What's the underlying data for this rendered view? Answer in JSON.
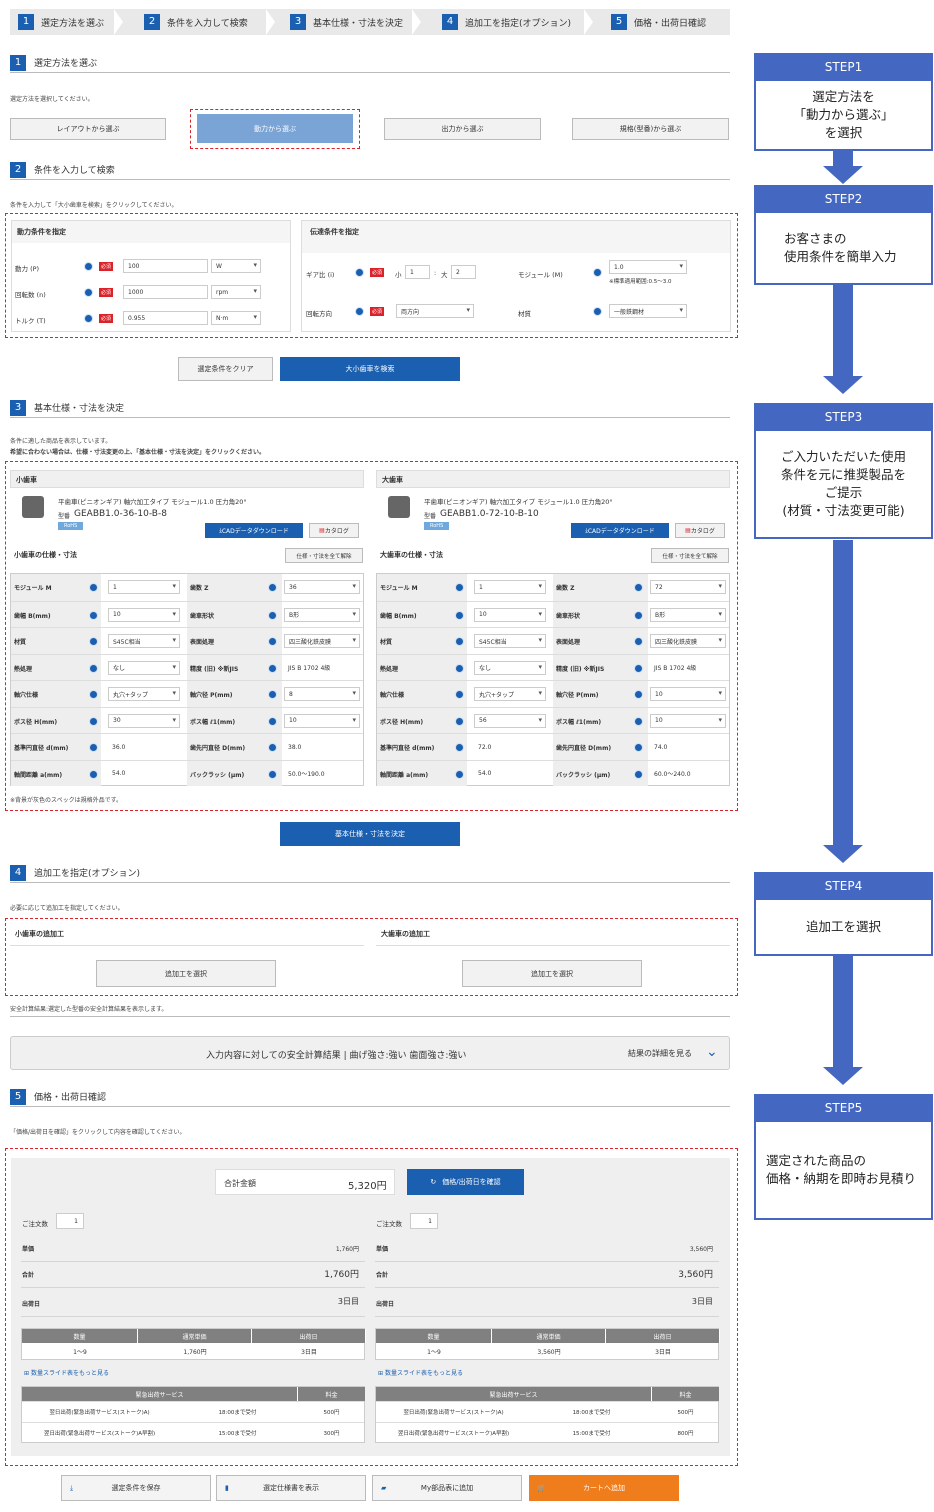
{
  "steps": [
    {
      "n": "1",
      "label": "選定方法を選ぶ"
    },
    {
      "n": "2",
      "label": "条件を入力して検索"
    },
    {
      "n": "3",
      "label": "基本仕様・寸法を決定"
    },
    {
      "n": "4",
      "label": "追加工を指定(オプション)"
    },
    {
      "n": "5",
      "label": "価格・出荷日確認"
    }
  ],
  "s1": {
    "title": "選定方法を選ぶ",
    "note": "選定方法を選択してください。",
    "buttons": [
      "レイアウトから選ぶ",
      "動力から選ぶ",
      "出力から選ぶ",
      "規格(型番)から選ぶ"
    ]
  },
  "s2": {
    "title": "条件を入力して検索",
    "note": "条件を入力して「大小歯車を検索」をクリックしてください。",
    "power_title": "動力条件を指定",
    "trans_title": "伝達条件を指定",
    "req": "必須",
    "power": [
      {
        "label": "動力 (P)",
        "value": "100",
        "unit": "W"
      },
      {
        "label": "回転数 (n)",
        "value": "1000",
        "unit": "rpm"
      },
      {
        "label": "トルク (T)",
        "value": "0.955",
        "unit": "N·m"
      }
    ],
    "ratio_label": "ギア比 (i)",
    "small": "小",
    "small_val": "1",
    "large": "大",
    "large_val": "2",
    "module_label": "モジュール (M)",
    "module_val": "1.0",
    "module_note": "※標準適用範囲:0.5〜3.0",
    "dir_label": "回転方向",
    "dir_val": "両方向",
    "mat_label": "材質",
    "mat_val": "一般鉄鋼材",
    "clear": "選定条件をクリア",
    "search": "大小歯車を検索"
  },
  "s3": {
    "title": "基本仕様・寸法を決定",
    "note1": "条件に適した商品を表示しています。",
    "note2": "希望に合わない場合は、仕様・寸法変更の上、「基本仕様・寸法を決定」をクリックください。",
    "footnote": "※背景が灰色のスペックは規格外品です。",
    "decide": "基本仕様・寸法を決定",
    "gears": [
      {
        "head": "小歯車",
        "name": "平歯車(ピニオンギア) 軸穴加工タイプ モジュール1.0 圧力角20°",
        "model_lbl": "型番",
        "model": "GEABB1.0-36-10-B-8",
        "rohs": "RoHS",
        "cad": "CADデータダウンロード",
        "catalog": "カタログ",
        "spec_title": "小歯車の仕様・寸法",
        "release": "仕様・寸法を全て解除",
        "specs": [
          [
            "モジュール M",
            "1",
            "歯数 Z",
            "36"
          ],
          [
            "歯幅 B(mm)",
            "10",
            "歯車形状",
            "B形"
          ],
          [
            "材質",
            "S45C相当",
            "表面処理",
            "四三酸化鉄皮膜"
          ],
          [
            "熱処理",
            "なし",
            "精度 (旧) ※新JIS",
            "JIS B 1702 4級"
          ],
          [
            "軸穴仕様",
            "丸穴+タップ",
            "軸穴径 P(mm)",
            "8"
          ],
          [
            "ボス径 H(mm)",
            "30",
            "ボス幅 ℓ1(mm)",
            "10"
          ],
          [
            "基準円直径 d(mm)",
            "36.0",
            "歯先円直径 D(mm)",
            "38.0"
          ],
          [
            "軸間距離 a(mm)",
            "54.0",
            "バックラッシ (μm)",
            "50.0〜190.0"
          ]
        ]
      },
      {
        "head": "大歯車",
        "name": "平歯車(ピニオンギア) 軸穴加工タイプ モジュール1.0 圧力角20°",
        "model_lbl": "型番",
        "model": "GEABB1.0-72-10-B-10",
        "rohs": "RoHS",
        "cad": "CADデータダウンロード",
        "catalog": "カタログ",
        "spec_title": "大歯車の仕様・寸法",
        "release": "仕様・寸法を全て解除",
        "specs": [
          [
            "モジュール M",
            "1",
            "歯数 Z",
            "72"
          ],
          [
            "歯幅 B(mm)",
            "10",
            "歯車形状",
            "B形"
          ],
          [
            "材質",
            "S45C相当",
            "表面処理",
            "四三酸化鉄皮膜"
          ],
          [
            "熱処理",
            "なし",
            "精度 (旧) ※新JIS",
            "JIS B 1702 4級"
          ],
          [
            "軸穴仕様",
            "丸穴+タップ",
            "軸穴径 P(mm)",
            "10"
          ],
          [
            "ボス径 H(mm)",
            "56",
            "ボス幅 ℓ1(mm)",
            "10"
          ],
          [
            "基準円直径 d(mm)",
            "72.0",
            "歯先円直径 D(mm)",
            "74.0"
          ],
          [
            "軸間距離 a(mm)",
            "54.0",
            "バックラッシ (μm)",
            "60.0〜240.0"
          ]
        ]
      }
    ]
  },
  "s4": {
    "title": "追加工を指定(オプション)",
    "note": "必要に応じて追加工を指定してください。",
    "small_head": "小歯車の追加工",
    "large_head": "大歯車の追加工",
    "btn": "追加工を選択"
  },
  "safety": {
    "note": "安全計算結果:選定した型番の安全計算結果を表示します。",
    "result": "入力内容に対しての安全計算結果 | 曲げ強さ:強い 歯面強さ:強い",
    "detail": "結果の詳細を見る"
  },
  "s5": {
    "title": "価格・出荷日確認",
    "note": "「価格/出荷日を確認」をクリックして内容を確認してください。",
    "total_lbl": "合計金額",
    "total": "5,320円",
    "confirm": "価格/出荷日を確認",
    "qty_lbl": "ご注文数",
    "unit_lbl": "単価",
    "sum_lbl": "合計",
    "ship_lbl": "出荷日",
    "th": [
      "数量",
      "通常単価",
      "出荷日"
    ],
    "more": "数量スライド表をもっと見る",
    "exp_th": [
      "緊急出荷サービス",
      "料金"
    ],
    "cols": [
      {
        "qty": "1",
        "unit": "1,760円",
        "sum": "1,760円",
        "ship": "3日目",
        "tr": [
          "1〜9",
          "1,760円",
          "3日目"
        ],
        "exp": [
          [
            "翌日出荷(緊急出荷サービス(ストーク)A)",
            "18:00まで受付",
            "500円"
          ],
          [
            "翌日出荷(緊急出荷サービス(ストーク)A早割)",
            "15:00まで受付",
            "300円"
          ]
        ]
      },
      {
        "qty": "1",
        "unit": "3,560円",
        "sum": "3,560円",
        "ship": "3日目",
        "tr": [
          "1〜9",
          "3,560円",
          "3日目"
        ],
        "exp": [
          [
            "翌日出荷(緊急出荷サービス(ストーク)A)",
            "18:00まで受付",
            "500円"
          ],
          [
            "翌日出荷(緊急出荷サービス(ストーク)A早割)",
            "15:00まで受付",
            "800円"
          ]
        ]
      }
    ]
  },
  "footer": [
    "選定条件を保存",
    "選定仕様書を表示",
    "My部品表に追加",
    "カートへ追加"
  ],
  "side": [
    {
      "h": "STEP1",
      "b": "選定方法を\n「動力から選ぶ」\nを選択"
    },
    {
      "h": "STEP2",
      "b": "お客さまの\n使用条件を簡単入力"
    },
    {
      "h": "STEP3",
      "b": "ご入力いただいた使用\n条件を元に推奨製品を\nご提示\n(材質・寸法変更可能)"
    },
    {
      "h": "STEP4",
      "b": "追加工を選択"
    },
    {
      "h": "STEP5",
      "b": "選定された商品の\n価格・納期を即時お見積り"
    }
  ],
  "colors": {
    "primary": "#1b5fb0",
    "side": "#4468c2",
    "red": "#d9222a",
    "orange": "#f07d1c"
  }
}
